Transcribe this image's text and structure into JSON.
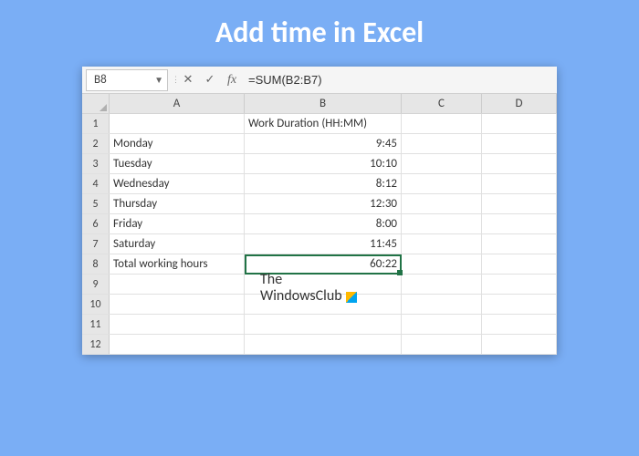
{
  "page_title": "Add time in Excel",
  "name_box": "B8",
  "formula": "=SUM(B2:B7)",
  "columns": [
    "A",
    "B",
    "C",
    "D"
  ],
  "row_numbers": [
    "1",
    "2",
    "3",
    "4",
    "5",
    "6",
    "7",
    "8",
    "9",
    "10",
    "11",
    "12"
  ],
  "grid": {
    "B1": "Work Duration (HH:MM)",
    "A2": "Monday",
    "B2": "9:45",
    "A3": "Tuesday",
    "B3": "10:10",
    "A4": "Wednesday",
    "B4": "8:12",
    "A5": "Thursday",
    "B5": "12:30",
    "A6": "Friday",
    "B6": "8:00",
    "A7": "Saturday",
    "B7": "11:45",
    "A8": "Total working hours",
    "B8": "60:22"
  },
  "selected_cell": "B8",
  "watermark": {
    "line1": "The",
    "line2": "WindowsClub"
  },
  "icons": {
    "cancel": "✕",
    "enter": "✓",
    "fx": "fx"
  }
}
